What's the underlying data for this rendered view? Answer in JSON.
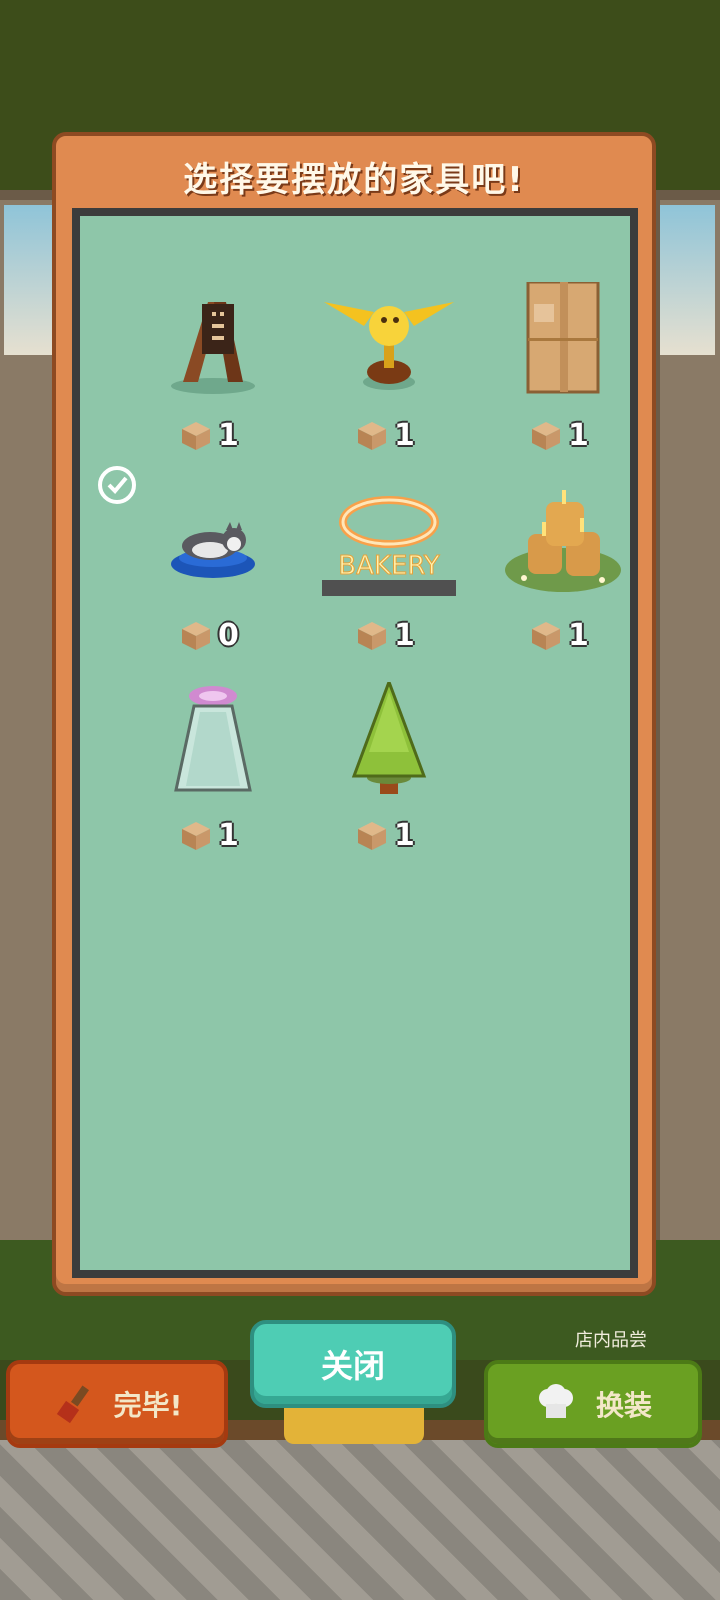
{
  "dialog": {
    "title": "选择要摆放的家具吧!",
    "close_label": "关闭"
  },
  "furniture_items": [
    {
      "name": "menu-sign",
      "count": "1",
      "selected": false
    },
    {
      "name": "golden-bird-trophy",
      "count": "1",
      "selected": false
    },
    {
      "name": "cardboard-box",
      "count": "1",
      "selected": false
    },
    {
      "name": "cat-bed",
      "count": "0",
      "selected": true
    },
    {
      "name": "bakery-neon-sign",
      "count": "1",
      "selected": false,
      "sign_text": "BAKERY"
    },
    {
      "name": "candle-cluster",
      "count": "1",
      "selected": false
    },
    {
      "name": "glass-dome-lamp",
      "count": "1",
      "selected": false
    },
    {
      "name": "pine-tree",
      "count": "1",
      "selected": false
    }
  ],
  "bottom_bar": {
    "done_label": "完毕!",
    "dress_label": "换装",
    "store_label": "店内品尝"
  },
  "colors": {
    "panel": "#e08a50",
    "inner": "#8ec6a9",
    "close_button": "#4ecdb4",
    "done_button": "#d4571d",
    "dress_button": "#6aa022"
  }
}
